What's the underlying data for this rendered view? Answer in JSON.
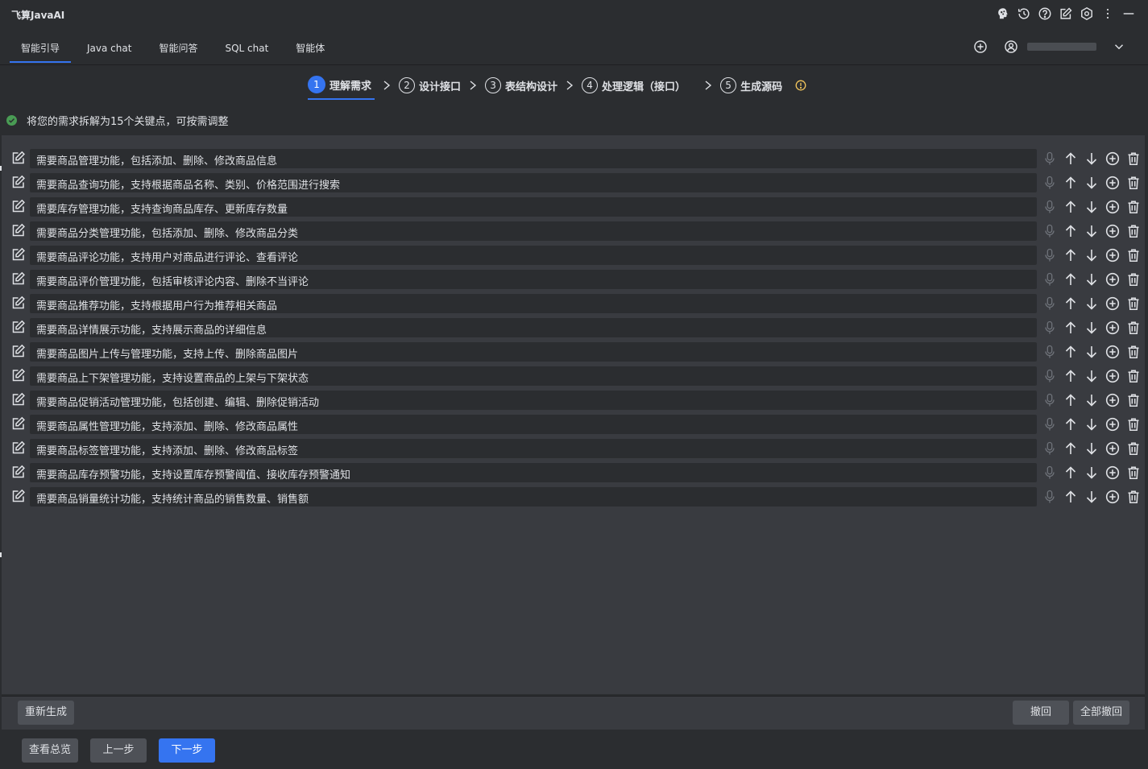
{
  "app": {
    "title": "飞算JavaAI"
  },
  "tabs": [
    {
      "label": "智能引导",
      "active": true
    },
    {
      "label": "Java chat",
      "active": false
    },
    {
      "label": "智能问答",
      "active": false
    },
    {
      "label": "SQL chat",
      "active": false
    },
    {
      "label": "智能体",
      "active": false
    }
  ],
  "title_icons": [
    "brain-icon",
    "history-icon",
    "help-icon",
    "edit-icon",
    "settings-icon",
    "more-vertical-icon",
    "minimize-icon"
  ],
  "steps": [
    {
      "num": "1",
      "label": "理解需求",
      "active": true
    },
    {
      "num": "2",
      "label": "设计接口",
      "active": false
    },
    {
      "num": "3",
      "label": "表结构设计",
      "active": false
    },
    {
      "num": "4",
      "label": "处理逻辑（接口）",
      "active": false
    },
    {
      "num": "5",
      "label": "生成源码",
      "active": false
    }
  ],
  "notice": {
    "text": "将您的需求拆解为15个关键点，可按需调整"
  },
  "requirements": [
    "需要商品管理功能，包括添加、删除、修改商品信息",
    "需要商品查询功能，支持根据商品名称、类别、价格范围进行搜索",
    "需要库存管理功能，支持查询商品库存、更新库存数量",
    "需要商品分类管理功能，包括添加、删除、修改商品分类",
    "需要商品评论功能，支持用户对商品进行评论、查看评论",
    "需要商品评价管理功能，包括审核评论内容、删除不当评论",
    "需要商品推荐功能，支持根据用户行为推荐相关商品",
    "需要商品详情展示功能，支持展示商品的详细信息",
    "需要商品图片上传与管理功能，支持上传、删除商品图片",
    "需要商品上下架管理功能，支持设置商品的上架与下架状态",
    "需要商品促销活动管理功能，包括创建、编辑、删除促销活动",
    "需要商品属性管理功能，支持添加、删除、修改商品属性",
    "需要商品标签管理功能，支持添加、删除、修改商品标签",
    "需要商品库存预警功能，支持设置库存预警阈值、接收库存预警通知",
    "需要商品销量统计功能，支持统计商品的销售数量、销售额"
  ],
  "actions": {
    "regenerate": "重新生成",
    "undo": "撤回",
    "undo_all": "全部撤回",
    "overview": "查看总览",
    "prev": "上一步",
    "next": "下一步"
  },
  "colors": {
    "background": "#2b2d30",
    "panel": "#393b40",
    "accent": "#3574f0",
    "success": "#499c54",
    "warning": "#f2c55c"
  }
}
